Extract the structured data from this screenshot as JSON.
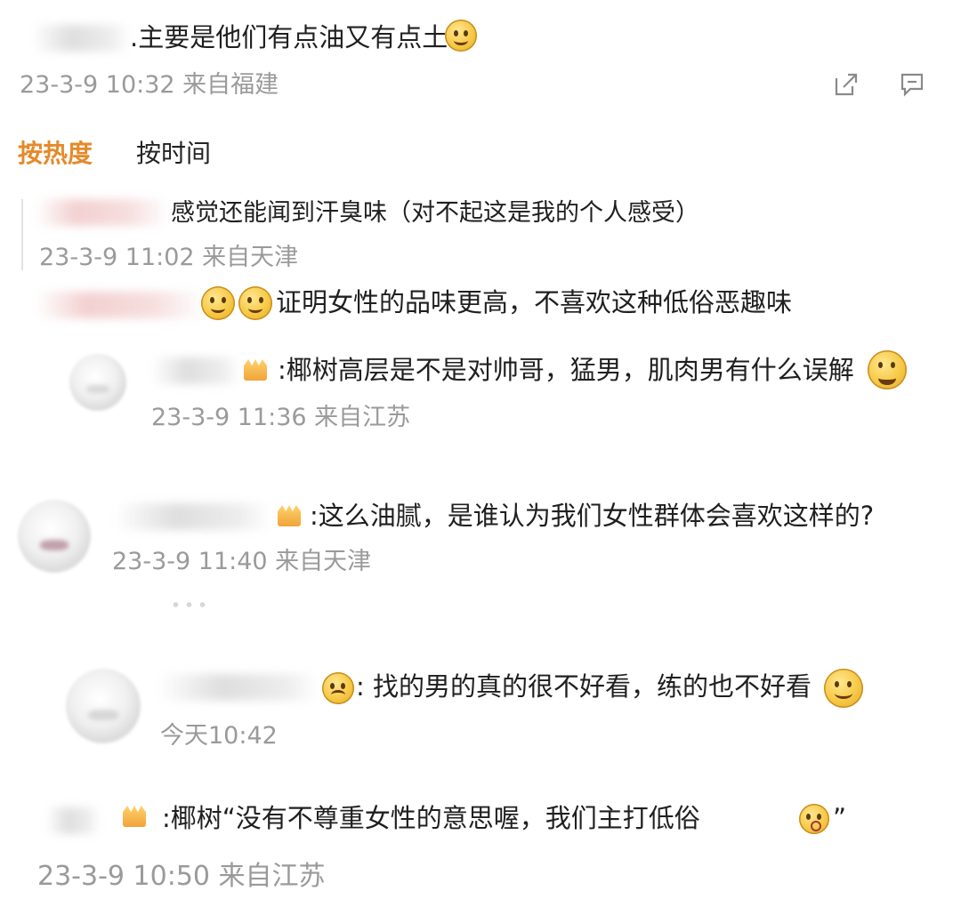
{
  "post": {
    "text": ".主要是他们有点油又有点土",
    "meta": "23-3-9 10:32 来自福建"
  },
  "sort_tabs": {
    "hot_label": "按热度",
    "time_label": "按时间"
  },
  "comments": [
    {
      "text": "感觉还能闻到汗臭味（对不起这是我的个人感受）",
      "meta": "23-3-9 11:02 来自天津"
    },
    {
      "text": "证明女性的品味更高，不喜欢这种低俗恶趣味"
    },
    {
      "text": ":椰树高层是不是对帅哥，猛男，肌肉男有什么误解",
      "meta": "23-3-9 11:36 来自江苏"
    },
    {
      "text": ":这么油腻，是谁认为我们女性群体会喜欢这样的?",
      "meta": "23-3-9 11:40 来自天津"
    },
    {
      "text": "找的男的真的很不好看，练的也不好看",
      "meta": "今天10:42"
    },
    {
      "text": ":椰树“没有不尊重女性的意思喔，我们主打低俗",
      "close_quote": "”",
      "meta": "23-3-9 10:50 来自江苏"
    }
  ],
  "icons": {
    "share": "share-icon",
    "comment": "comment-icon",
    "accent_color": "#e58a2a"
  }
}
